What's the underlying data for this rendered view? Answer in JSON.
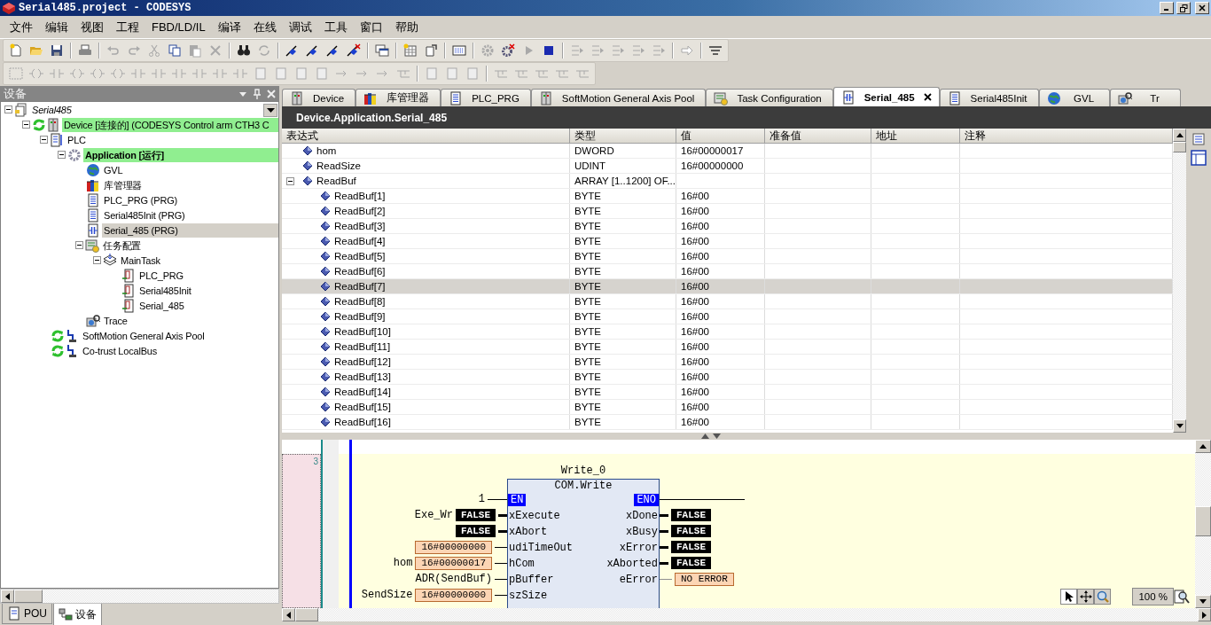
{
  "window": {
    "title": "Serial485.project - CODESYS"
  },
  "menu": [
    "文件",
    "编辑",
    "视图",
    "工程",
    "FBD/LD/IL",
    "编译",
    "在线",
    "调试",
    "工具",
    "窗口",
    "帮助"
  ],
  "toolbar_main": [
    {
      "disabled": false
    },
    {
      "disabled": false
    },
    {
      "disabled": false
    },
    {
      "disabled": false
    },
    {
      "disabled": true
    },
    {
      "disabled": true
    },
    {
      "disabled": true
    },
    {
      "disabled": false
    },
    {
      "disabled": true
    },
    {
      "disabled": true
    },
    {
      "disabled": false
    },
    {
      "disabled": true
    },
    {
      "disabled": false
    },
    {
      "disabled": false
    },
    {
      "disabled": false
    },
    {
      "disabled": false
    },
    {
      "disabled": false
    },
    {
      "disabled": false
    },
    {
      "disabled": false
    },
    {
      "disabled": false
    },
    {
      "disabled": true
    },
    {
      "disabled": false
    },
    {
      "disabled": true
    },
    {
      "disabled": false
    },
    {
      "disabled": true
    },
    {
      "disabled": true
    },
    {
      "disabled": true
    },
    {
      "disabled": true
    },
    {
      "disabled": true
    },
    {
      "disabled": true
    },
    {
      "disabled": false
    }
  ],
  "toolbar_editor": [
    {
      "disabled": true
    },
    {
      "disabled": true
    },
    {
      "disabled": true
    },
    {
      "disabled": true
    },
    {
      "disabled": true
    },
    {
      "disabled": true
    },
    {
      "disabled": true
    },
    {
      "disabled": true
    },
    {
      "disabled": true
    },
    {
      "disabled": true
    },
    {
      "disabled": true
    },
    {
      "disabled": true
    },
    {
      "disabled": true
    },
    {
      "disabled": true
    },
    {
      "disabled": true
    },
    {
      "disabled": true
    },
    {
      "disabled": true
    },
    {
      "disabled": true
    },
    {
      "disabled": true
    },
    {
      "disabled": true
    },
    {
      "disabled": true
    },
    {
      "disabled": true
    },
    {
      "disabled": true
    },
    {
      "disabled": true
    },
    {
      "disabled": true
    },
    {
      "disabled": true
    },
    {
      "disabled": true
    },
    {
      "disabled": true
    }
  ],
  "devices_panel": {
    "title": "设备",
    "tree": [
      {
        "label": "Serial485",
        "kind": "project",
        "expanded": true,
        "selected": false,
        "highlighted": false,
        "children": [
          {
            "label": "Device [连接的] (CODESYS Control arm CTH3 C",
            "kind": "device",
            "expanded": true,
            "selected": false,
            "highlighted": true,
            "children": [
              {
                "label": "PLC",
                "kind": "plc",
                "expanded": true,
                "selected": false,
                "highlighted": false,
                "children": [
                  {
                    "label": "Application [运行]",
                    "kind": "application",
                    "expanded": true,
                    "selected": false,
                    "highlighted": true,
                    "children": [
                      {
                        "label": "GVL",
                        "kind": "gvl",
                        "selected": false,
                        "highlighted": false
                      },
                      {
                        "label": "库管理器",
                        "kind": "library",
                        "selected": false,
                        "highlighted": false
                      },
                      {
                        "label": "PLC_PRG (PRG)",
                        "kind": "program",
                        "selected": false,
                        "highlighted": false
                      },
                      {
                        "label": "Serial485Init (PRG)",
                        "kind": "program",
                        "selected": false,
                        "highlighted": false
                      },
                      {
                        "label": "Serial_485 (PRG)",
                        "kind": "fbd-program",
                        "selected": true,
                        "highlighted": false
                      },
                      {
                        "label": "任务配置",
                        "kind": "task-config",
                        "expanded": true,
                        "selected": false,
                        "highlighted": false,
                        "children": [
                          {
                            "label": "MainTask",
                            "kind": "task",
                            "expanded": true,
                            "selected": false,
                            "highlighted": false,
                            "children": [
                              {
                                "label": "PLC_PRG",
                                "kind": "call",
                                "selected": false,
                                "highlighted": false
                              },
                              {
                                "label": "Serial485Init",
                                "kind": "call",
                                "selected": false,
                                "highlighted": false
                              },
                              {
                                "label": "Serial_485",
                                "kind": "call",
                                "selected": false,
                                "highlighted": false
                              }
                            ]
                          }
                        ]
                      },
                      {
                        "label": "Trace",
                        "kind": "trace",
                        "selected": false,
                        "highlighted": false
                      }
                    ]
                  }
                ]
              },
              {
                "label": "SoftMotion General Axis Pool",
                "kind": "axis-pool",
                "selected": false,
                "highlighted": false
              },
              {
                "label": "Co-trust LocalBus",
                "kind": "bus",
                "selected": false,
                "highlighted": false
              }
            ]
          }
        ]
      }
    ],
    "bottom_tabs": [
      {
        "label": "POU",
        "kind": "pou",
        "selected": false
      },
      {
        "label": "设备",
        "kind": "devices",
        "selected": true
      }
    ]
  },
  "editor_tabs": [
    {
      "label": "Device",
      "kind": "device",
      "selected": false
    },
    {
      "label": "库管理器",
      "kind": "library",
      "selected": false
    },
    {
      "label": "PLC_PRG",
      "kind": "program",
      "selected": false
    },
    {
      "label": "SoftMotion General Axis Pool",
      "kind": "device",
      "selected": false
    },
    {
      "label": "Task Configuration",
      "kind": "task-config",
      "selected": false
    },
    {
      "label": "Serial_485",
      "kind": "fbd-program",
      "selected": true
    },
    {
      "label": "Serial485Init",
      "kind": "program",
      "selected": false
    },
    {
      "label": "GVL",
      "kind": "gvl",
      "selected": false
    },
    {
      "label": "Tr",
      "kind": "trace",
      "selected": false
    }
  ],
  "editor_path": "Device.Application.Serial_485",
  "watch_table": {
    "columns": [
      "表达式",
      "类型",
      "值",
      "准备值",
      "地址",
      "注释"
    ],
    "rows": [
      {
        "expression": "hom",
        "type": "DWORD",
        "value": "16#00000017",
        "selected": false
      },
      {
        "expression": "ReadSize",
        "type": "UDINT",
        "value": "16#00000000",
        "selected": false
      },
      {
        "expression": "ReadBuf",
        "type": "ARRAY [1..1200] OF...",
        "selected": false,
        "expanded": true,
        "children": [
          {
            "expression": "ReadBuf[1]",
            "type": "BYTE",
            "value": "16#00",
            "selected": false
          },
          {
            "expression": "ReadBuf[2]",
            "type": "BYTE",
            "value": "16#00",
            "selected": false
          },
          {
            "expression": "ReadBuf[3]",
            "type": "BYTE",
            "value": "16#00",
            "selected": false
          },
          {
            "expression": "ReadBuf[4]",
            "type": "BYTE",
            "value": "16#00",
            "selected": false
          },
          {
            "expression": "ReadBuf[5]",
            "type": "BYTE",
            "value": "16#00",
            "selected": false
          },
          {
            "expression": "ReadBuf[6]",
            "type": "BYTE",
            "value": "16#00",
            "selected": false
          },
          {
            "expression": "ReadBuf[7]",
            "type": "BYTE",
            "value": "16#00",
            "selected": true
          },
          {
            "expression": "ReadBuf[8]",
            "type": "BYTE",
            "value": "16#00",
            "selected": false
          },
          {
            "expression": "ReadBuf[9]",
            "type": "BYTE",
            "value": "16#00",
            "selected": false
          },
          {
            "expression": "ReadBuf[10]",
            "type": "BYTE",
            "value": "16#00",
            "selected": false
          },
          {
            "expression": "ReadBuf[11]",
            "type": "BYTE",
            "value": "16#00",
            "selected": false
          },
          {
            "expression": "ReadBuf[12]",
            "type": "BYTE",
            "value": "16#00",
            "selected": false
          },
          {
            "expression": "ReadBuf[13]",
            "type": "BYTE",
            "value": "16#00",
            "selected": false
          },
          {
            "expression": "ReadBuf[14]",
            "type": "BYTE",
            "value": "16#00",
            "selected": false
          },
          {
            "expression": "ReadBuf[15]",
            "type": "BYTE",
            "value": "16#00",
            "selected": false
          },
          {
            "expression": "ReadBuf[16]",
            "type": "BYTE",
            "value": "16#00",
            "selected": false
          }
        ]
      }
    ]
  },
  "fbd": {
    "network_number": "3",
    "instance": "Write_0",
    "block_type": "COM.Write",
    "en_input": "1",
    "en": "EN",
    "eno": "ENO",
    "inputs": [
      {
        "pin": "xExecute",
        "variable": "Exe_Wr",
        "value": "FALSE",
        "kind": "bool"
      },
      {
        "pin": "xAbort",
        "value": "FALSE",
        "kind": "bool"
      },
      {
        "pin": "udiTimeOut",
        "value": "16#00000000",
        "kind": "number"
      },
      {
        "pin": "hCom",
        "variable": "hom",
        "value": "16#00000017",
        "kind": "number"
      },
      {
        "pin": "pBuffer",
        "variable": "ADR(SendBuf)",
        "kind": "expression"
      },
      {
        "pin": "szSize",
        "variable": "SendSize",
        "value": "16#00000000",
        "kind": "number"
      }
    ],
    "outputs": [
      {
        "pin": "xDone",
        "value": "FALSE",
        "kind": "bool"
      },
      {
        "pin": "xBusy",
        "value": "FALSE",
        "kind": "bool"
      },
      {
        "pin": "xError",
        "value": "FALSE",
        "kind": "bool"
      },
      {
        "pin": "xAborted",
        "value": "FALSE",
        "kind": "bool"
      },
      {
        "pin": "eError",
        "value": "NO ERROR",
        "kind": "enum"
      }
    ],
    "zoom_level": "100 %"
  }
}
